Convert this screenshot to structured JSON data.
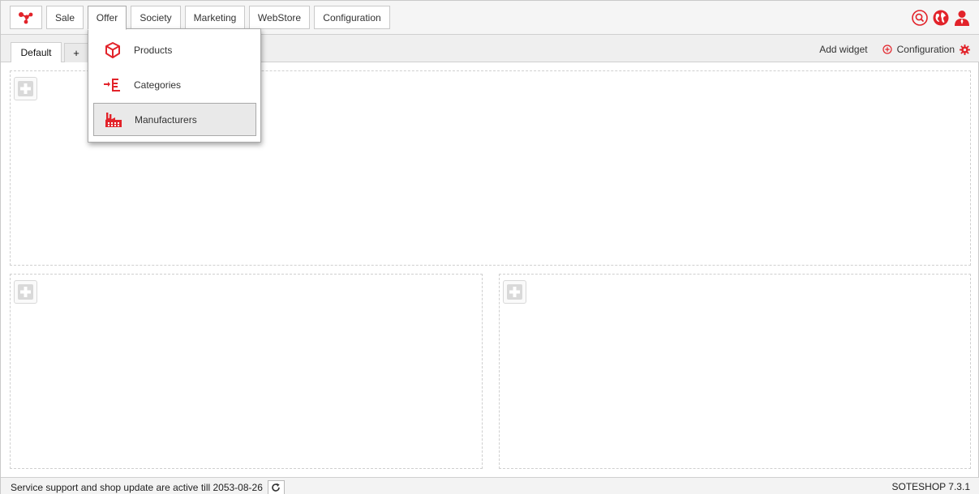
{
  "topnav": {
    "logo_icon": "network-logo-icon",
    "items": [
      {
        "label": "Sale"
      },
      {
        "label": "Offer",
        "active": true
      },
      {
        "label": "Society"
      },
      {
        "label": "Marketing"
      },
      {
        "label": "WebStore"
      },
      {
        "label": "Configuration"
      }
    ],
    "right_icons": [
      "search-icon",
      "globe-icon",
      "user-icon"
    ],
    "accent_color": "#e2232a"
  },
  "tabs": {
    "items": [
      {
        "label": "Default",
        "active": true
      },
      {
        "label": "+"
      }
    ],
    "add_widget_label": "Add widget",
    "configuration_label": "Configuration"
  },
  "offer_menu": {
    "items": [
      {
        "label": "Products",
        "icon": "box-icon"
      },
      {
        "label": "Categories",
        "icon": "category-tree-icon"
      },
      {
        "label": "Manufacturers",
        "icon": "factory-icon",
        "hovered": true
      }
    ]
  },
  "widget_areas": [
    {
      "name": "top",
      "add_icon": "add-widget-icon"
    },
    {
      "name": "bottom-left",
      "add_icon": "add-widget-icon"
    },
    {
      "name": "bottom-right",
      "add_icon": "add-widget-icon"
    }
  ],
  "footer": {
    "support_text": "Service support and shop update are active till 2053-08-26",
    "version": "SOTESHOP 7.3.1"
  }
}
